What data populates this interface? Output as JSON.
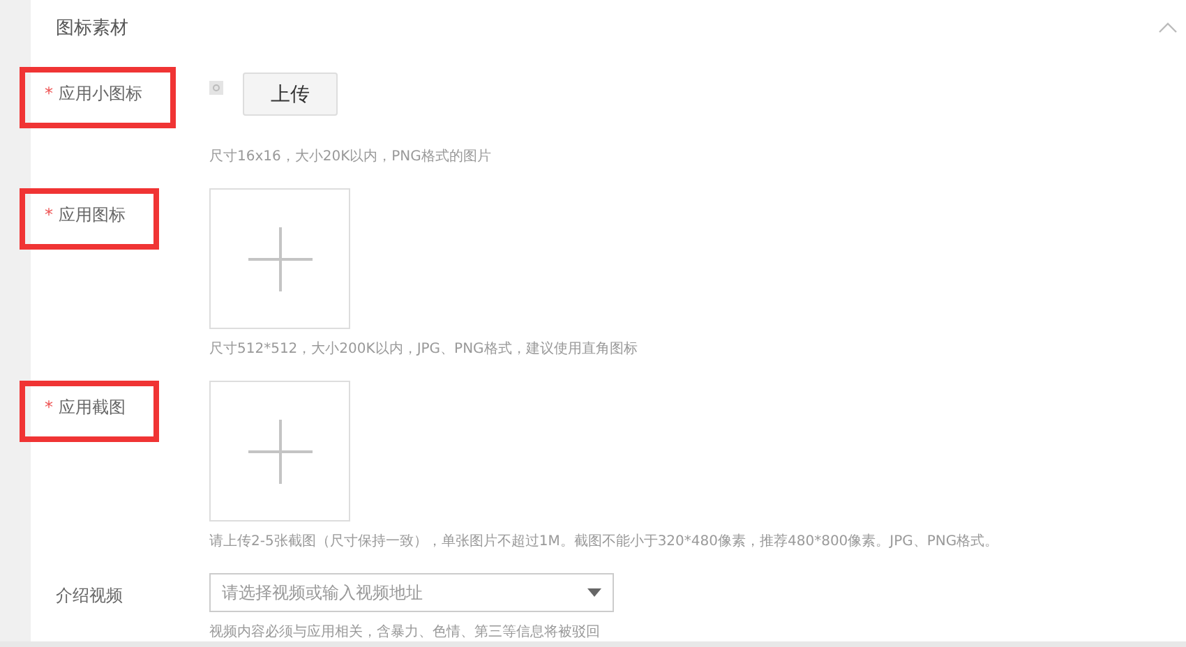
{
  "section": {
    "title": "图标素材",
    "expanded": true
  },
  "fields": [
    {
      "kind": "icon-upload",
      "marker": "*",
      "label": "应用小图标",
      "highlighted": true,
      "button": "上传",
      "hint": "尺寸16x16，大小20K以内，PNG格式的图片"
    },
    {
      "kind": "image-upload",
      "marker": "*",
      "label": "应用图标",
      "highlighted": true,
      "hint": "尺寸512*512，大小200K以内，JPG、PNG格式，建议使用直角图标"
    },
    {
      "kind": "image-upload",
      "marker": "*",
      "label": "应用截图",
      "highlighted": true,
      "hint": "请上传2-5张截图（尺寸保持一致），单张图片不超过1M。截图不能小于320*480像素，推荐480*800像素。JPG、PNG格式。"
    },
    {
      "kind": "select",
      "label": "介绍视频",
      "highlighted": false,
      "placeholder": "请选择视频或输入视频地址",
      "hint": "视频内容必须与应用相关，含暴力、色情、第三等信息将被驳回"
    }
  ]
}
